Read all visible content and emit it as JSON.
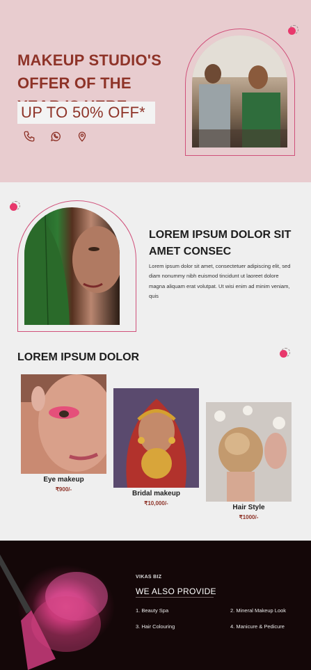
{
  "hero": {
    "title": "MAKEUP STUDIO'S OFFER OF THE YEAR IS HERE",
    "offer": "UP TO 50% OFF*",
    "contact_icons": [
      "phone-icon",
      "whatsapp-icon",
      "location-icon"
    ],
    "accent_color": "#8e3328",
    "background_color": "#e8cccf"
  },
  "about": {
    "title": "LOREM IPSUM DOLOR SIT AMET CONSEC",
    "text": "Lorem ipsum dolor sit amet, consectetuer adipiscing elit, sed diam nonummy nibh euismod tincidunt ut laoreet dolore magna aliquam erat volutpat. Ut wisi enim ad minim veniam, quis"
  },
  "services": {
    "title": "LOREM IPSUM DOLOR",
    "items": [
      {
        "name": "Eye makeup",
        "price": "₹900/-"
      },
      {
        "name": "Bridal makeup",
        "price": "₹10,000/-"
      },
      {
        "name": "Hair Style",
        "price": "₹1000/-"
      }
    ]
  },
  "footer": {
    "brand": "VIKAS BIZ",
    "title": "WE ALSO PROVIDE",
    "items": [
      "1. Beauty Spa",
      "2. Mineral Makeup Look",
      "3. Hair Colouring",
      "4. Manicure & Pedicure"
    ],
    "background_color": "#140708"
  }
}
